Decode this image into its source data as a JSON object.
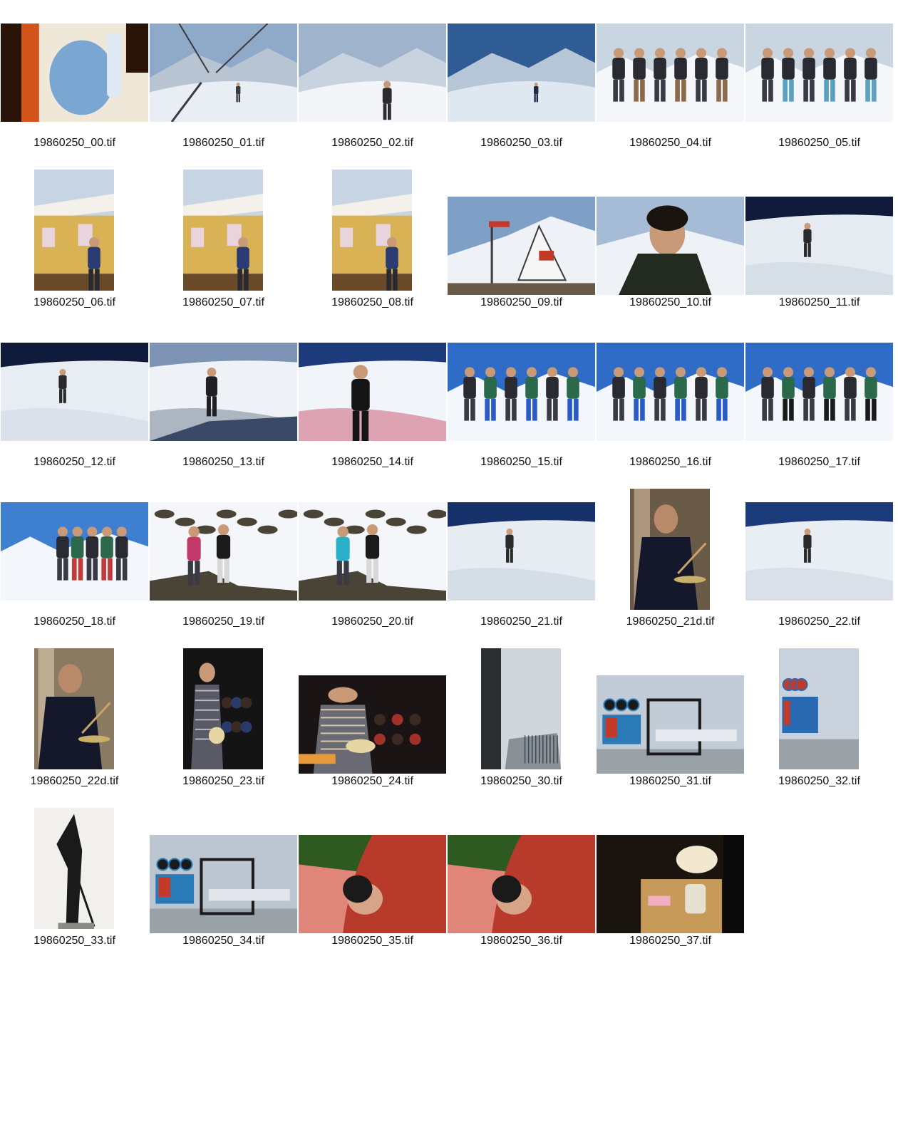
{
  "contact_sheet": {
    "items": [
      {
        "filename": "19860250_00.tif",
        "orientation": "landscape",
        "scene": "still-life",
        "palette": [
          "#2a1408",
          "#d2541a",
          "#7aa6d2",
          "#efe8d8"
        ]
      },
      {
        "filename": "19860250_01.tif",
        "orientation": "landscape",
        "scene": "ski-lift",
        "palette": [
          "#8fa9c9",
          "#e9eef4",
          "#3a3a44",
          "#b8c4d2"
        ]
      },
      {
        "filename": "19860250_02.tif",
        "orientation": "landscape",
        "scene": "ski-slope",
        "palette": [
          "#9fb3cc",
          "#f3f5f8",
          "#2b2b30",
          "#c9d3df"
        ]
      },
      {
        "filename": "19860250_03.tif",
        "orientation": "landscape",
        "scene": "mountain-valley",
        "palette": [
          "#2f5c94",
          "#dfe8f1",
          "#1d2d44",
          "#b7c6d6"
        ]
      },
      {
        "filename": "19860250_04.tif",
        "orientation": "landscape",
        "scene": "group-skiers",
        "palette": [
          "#c9d6e2",
          "#f4f6f9",
          "#2a2a32",
          "#8a6a4a"
        ]
      },
      {
        "filename": "19860250_05.tif",
        "orientation": "landscape",
        "scene": "group-skiers",
        "palette": [
          "#c9d6e2",
          "#f4f6f9",
          "#2a2a32",
          "#5aa0c0"
        ]
      },
      {
        "filename": "19860250_06.tif",
        "orientation": "portrait",
        "scene": "chalet",
        "palette": [
          "#d9b256",
          "#f4f1ea",
          "#2b3c72",
          "#6b4a2a"
        ]
      },
      {
        "filename": "19860250_07.tif",
        "orientation": "portrait",
        "scene": "chalet",
        "palette": [
          "#d9b256",
          "#f4f1ea",
          "#2b3c72",
          "#6b4a2a"
        ]
      },
      {
        "filename": "19860250_08.tif",
        "orientation": "portrait",
        "scene": "chalet",
        "palette": [
          "#d9b256",
          "#f4f1ea",
          "#2b3c72",
          "#6b4a2a"
        ]
      },
      {
        "filename": "19860250_09.tif",
        "orientation": "landscape",
        "scene": "piz-buin-sign",
        "palette": [
          "#7fa0c6",
          "#eef1f5",
          "#3a3a3a",
          "#c23b2a"
        ]
      },
      {
        "filename": "19860250_10.tif",
        "orientation": "landscape",
        "scene": "portrait-drinking",
        "palette": [
          "#a6bcd6",
          "#eef2f6",
          "#232a20",
          "#c89a78"
        ]
      },
      {
        "filename": "19860250_11.tif",
        "orientation": "landscape",
        "scene": "skier-dark-sky",
        "palette": [
          "#101a3a",
          "#e6ebf1",
          "#2a2a2a",
          "#bfcad7"
        ]
      },
      {
        "filename": "19860250_12.tif",
        "orientation": "landscape",
        "scene": "skier-dark-sky",
        "palette": [
          "#101a3a",
          "#e8edf3",
          "#2a2a2a",
          "#c5cfdb"
        ]
      },
      {
        "filename": "19860250_13.tif",
        "orientation": "landscape",
        "scene": "skier-slope",
        "palette": [
          "#7c93b3",
          "#eef2f6",
          "#1f1f24",
          "#4a5a72"
        ]
      },
      {
        "filename": "19860250_14.tif",
        "orientation": "landscape",
        "scene": "skier-closeup",
        "palette": [
          "#1d3a7a",
          "#f1f4f8",
          "#151515",
          "#c22a4a"
        ]
      },
      {
        "filename": "19860250_15.tif",
        "orientation": "landscape",
        "scene": "group-blue-sky",
        "palette": [
          "#2e6cc8",
          "#f3f6fa",
          "#2a6a4a",
          "#2a5ac8"
        ]
      },
      {
        "filename": "19860250_16.tif",
        "orientation": "landscape",
        "scene": "group-blue-sky",
        "palette": [
          "#2e6cc8",
          "#f3f6fa",
          "#2a6a4a",
          "#2a5ac8"
        ]
      },
      {
        "filename": "19860250_17.tif",
        "orientation": "landscape",
        "scene": "group-blue-sky",
        "palette": [
          "#2e6cc8",
          "#f3f6fa",
          "#2a6a4a",
          "#1a1a1a"
        ]
      },
      {
        "filename": "19860250_18.tif",
        "orientation": "landscape",
        "scene": "group-panorama",
        "palette": [
          "#3f7fcf",
          "#f3f6fa",
          "#2a6a4a",
          "#c23a3a"
        ]
      },
      {
        "filename": "19860250_19.tif",
        "orientation": "landscape",
        "scene": "rocks-sitting",
        "palette": [
          "#b9c9dc",
          "#f4f6f9",
          "#4a4436",
          "#c23a6a"
        ]
      },
      {
        "filename": "19860250_20.tif",
        "orientation": "landscape",
        "scene": "rocks-sitting",
        "palette": [
          "#b9c9dc",
          "#f4f6f9",
          "#4a4436",
          "#2ab0c8"
        ]
      },
      {
        "filename": "19860250_21.tif",
        "orientation": "landscape",
        "scene": "skier-dark-sky",
        "palette": [
          "#16306a",
          "#e7ecf2",
          "#2a2a2a",
          "#bcc7d4"
        ]
      },
      {
        "filename": "19860250_21d.tif",
        "orientation": "portrait",
        "scene": "drummer",
        "palette": [
          "#6a5a48",
          "#d8c0a4",
          "#14182a",
          "#b88a6a"
        ]
      },
      {
        "filename": "19860250_22.tif",
        "orientation": "landscape",
        "scene": "skier-dark-sky",
        "palette": [
          "#1a3a7a",
          "#e9eef4",
          "#2a2a2a",
          "#c0cbd8"
        ]
      },
      {
        "filename": "19860250_22d.tif",
        "orientation": "portrait",
        "scene": "drummer",
        "palette": [
          "#8a7a62",
          "#e0ccb2",
          "#14182a",
          "#b88a6a"
        ]
      },
      {
        "filename": "19860250_23.tif",
        "orientation": "portrait",
        "scene": "guitarist",
        "palette": [
          "#141414",
          "#5a5a66",
          "#2a3a6a",
          "#b8b8c2"
        ]
      },
      {
        "filename": "19860250_24.tif",
        "orientation": "landscape",
        "scene": "concert-crowd",
        "palette": [
          "#1a1414",
          "#6a6a74",
          "#a0322a",
          "#d6c8a8"
        ]
      },
      {
        "filename": "19860250_30.tif",
        "orientation": "portrait",
        "scene": "balcony-fog",
        "palette": [
          "#cfd6dc",
          "#8a9096",
          "#2a2e30",
          "#b8c0c6"
        ]
      },
      {
        "filename": "19860250_31.tif",
        "orientation": "landscape",
        "scene": "ferry-pier",
        "palette": [
          "#c2ccd6",
          "#2a7ab8",
          "#1a1a1a",
          "#e6eaee"
        ]
      },
      {
        "filename": "19860250_32.tif",
        "orientation": "portrait",
        "scene": "pier-sign",
        "palette": [
          "#c9d2dc",
          "#2a6ab0",
          "#c23a2a",
          "#1a1a2a"
        ]
      },
      {
        "filename": "19860250_33.tif",
        "orientation": "portrait",
        "scene": "statue",
        "palette": [
          "#f2f0ec",
          "#1a1a1a",
          "#8a8a86",
          "#d8d6d0"
        ]
      },
      {
        "filename": "19860250_34.tif",
        "orientation": "landscape",
        "scene": "ferry-pier",
        "palette": [
          "#bcc6d0",
          "#2a7ab8",
          "#1a1a1a",
          "#e2e6ea"
        ]
      },
      {
        "filename": "19860250_35.tif",
        "orientation": "landscape",
        "scene": "sleeping",
        "palette": [
          "#2e5a22",
          "#e0857a",
          "#b83a2a",
          "#1a1a1a"
        ]
      },
      {
        "filename": "19860250_36.tif",
        "orientation": "landscape",
        "scene": "sleeping",
        "palette": [
          "#2e5a22",
          "#e0857a",
          "#b83a2a",
          "#1a1a1a"
        ]
      },
      {
        "filename": "19860250_37.tif",
        "orientation": "landscape",
        "scene": "desk-lamp",
        "palette": [
          "#1a140e",
          "#c89a5a",
          "#f2e8d0",
          "#6a4a2a"
        ]
      }
    ]
  }
}
